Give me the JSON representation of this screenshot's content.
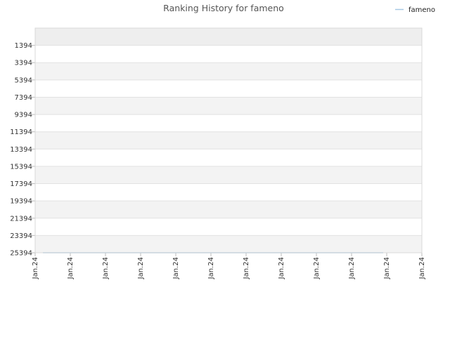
{
  "chart_data": {
    "type": "line",
    "title": "Ranking History for fameno",
    "xlabel": "",
    "ylabel": "",
    "y_ticks": [
      "1394",
      "3394",
      "5394",
      "7394",
      "9394",
      "11394",
      "13394",
      "15394",
      "17394",
      "19394",
      "21394",
      "23394",
      "25394"
    ],
    "x_ticks": [
      "Jan.24",
      "Jan.24",
      "Jan.24",
      "Jan.24",
      "Jan.24",
      "Jan.24",
      "Jan.24",
      "Jan.24",
      "Jan.24",
      "Jan.24",
      "Jan.24",
      "Jan.24"
    ],
    "ylim": [
      -606,
      25394
    ],
    "y_inverted": true,
    "grid": true,
    "legend_position": "top-right",
    "series": [
      {
        "name": "fameno",
        "color": "#a6c8e4",
        "x_fraction": [
          0.02,
          0.9
        ],
        "values": [
          25394,
          25394
        ]
      }
    ]
  }
}
